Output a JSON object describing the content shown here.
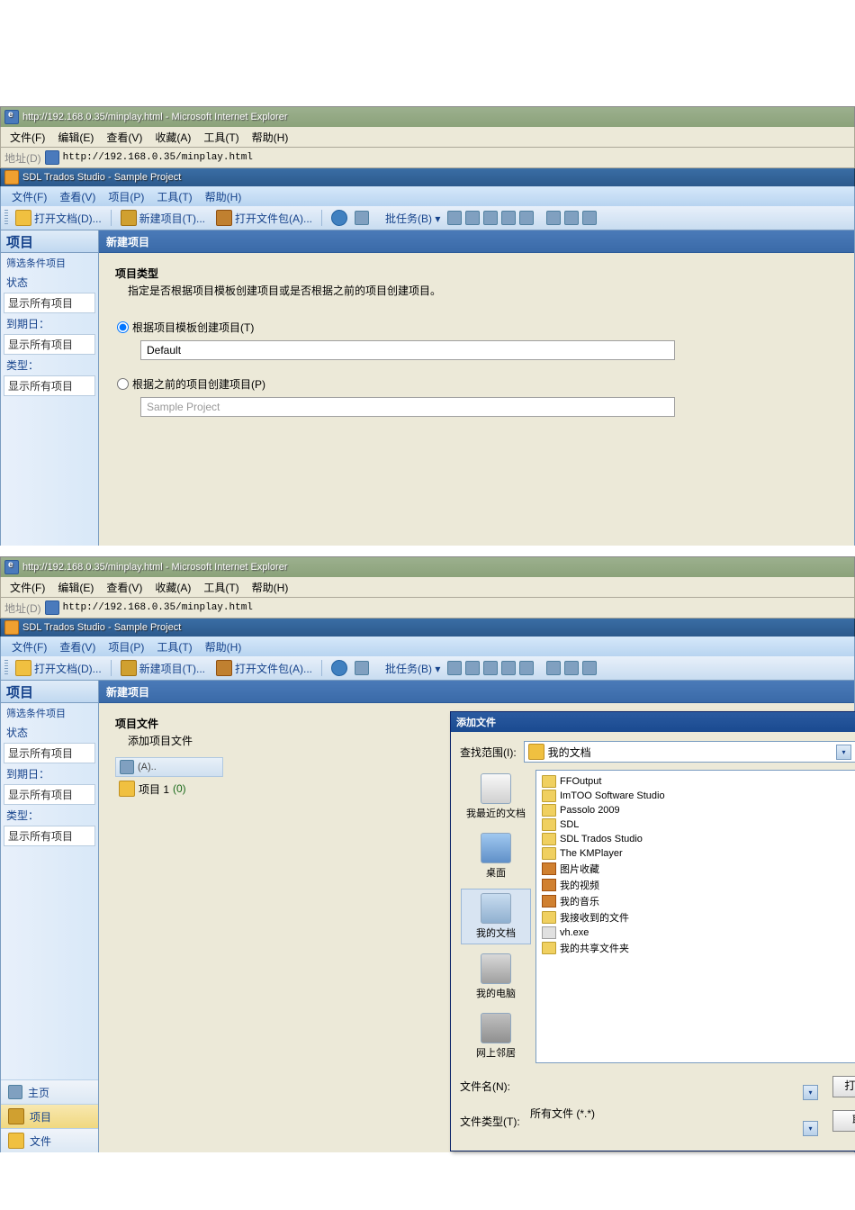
{
  "ie": {
    "title": "http://192.168.0.35/minplay.html - Microsoft Internet Explorer",
    "menu": {
      "file": "文件(F)",
      "edit": "编辑(E)",
      "view": "查看(V)",
      "fav": "收藏(A)",
      "tools": "工具(T)",
      "help": "帮助(H)"
    },
    "addr_label": "地址(D)",
    "url": "http://192.168.0.35/minplay.html"
  },
  "trados": {
    "title": "SDL Trados Studio - Sample Project",
    "menu": {
      "file": "文件(F)",
      "view": "查看(V)",
      "project": "项目(P)",
      "tools": "工具(T)",
      "help": "帮助(H)"
    },
    "tb": {
      "open": "打开文档(D)...",
      "new": "新建项目(T)...",
      "openpkg": "打开文件包(A)...",
      "batch": "批任务(B) ▾"
    }
  },
  "sidebar": {
    "head": "项目",
    "group": "筛选条件项目",
    "rows": [
      {
        "lbl": "状态",
        "val": "显示所有项目"
      },
      {
        "lbl": "到期日：",
        "val": "显示所有项目"
      },
      {
        "lbl": "类型：",
        "val": "显示所有项目"
      }
    ],
    "nav": {
      "home": "主页",
      "project": "项目",
      "file": "文件"
    }
  },
  "wizard1": {
    "head": "新建项目",
    "title": "项目类型",
    "sub": "指定是否根据项目模板创建项目或是否根据之前的项目创建项目。",
    "opt1": "根据项目模板创建项目(T)",
    "opt1_val": "Default",
    "opt2": "根据之前的项目创建项目(P)",
    "opt2_val": "Sample Project"
  },
  "wizard2": {
    "head": "新建项目",
    "title": "项目文件",
    "sub": "添加项目文件",
    "tree_hdr": "(A)..",
    "tree_item": "项目 1",
    "tree_count": "(0)"
  },
  "dialog": {
    "title": "添加文件",
    "look_in": "查找范围(I):",
    "folder": "我的文档",
    "places": {
      "recent": "我最近的文档",
      "desktop": "桌面",
      "mydocs": "我的文档",
      "mycomputer": "我的电脑",
      "network": "网上邻居"
    },
    "files": [
      {
        "t": "folder",
        "n": "FFOutput"
      },
      {
        "t": "folder",
        "n": "ImTOO Software Studio"
      },
      {
        "t": "folder",
        "n": "Passolo 2009"
      },
      {
        "t": "folder",
        "n": "SDL"
      },
      {
        "t": "folder",
        "n": "SDL Trados Studio"
      },
      {
        "t": "folder",
        "n": "The KMPlayer"
      },
      {
        "t": "media",
        "n": "图片收藏"
      },
      {
        "t": "media",
        "n": "我的视频"
      },
      {
        "t": "media",
        "n": "我的音乐"
      },
      {
        "t": "folder",
        "n": "我接收到的文件"
      },
      {
        "t": "doc",
        "n": "vh.exe"
      },
      {
        "t": "folder",
        "n": "我的共享文件夹"
      }
    ],
    "fname_lbl": "文件名(N):",
    "ftype_lbl": "文件类型(T):",
    "ftype_val": "所有文件 (*.*)",
    "open": "打开(O)",
    "cancel": "取消"
  }
}
